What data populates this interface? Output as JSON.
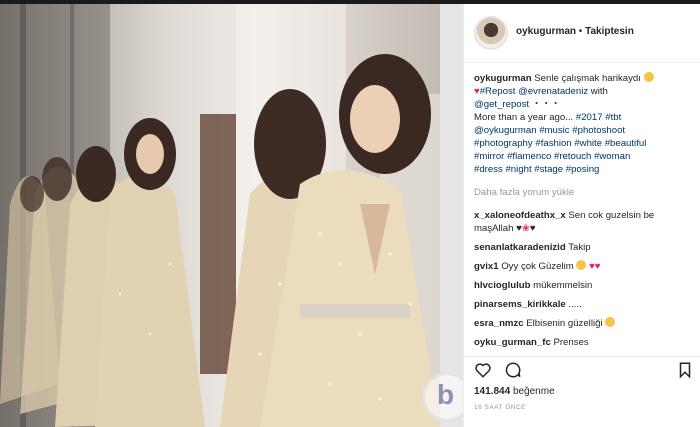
{
  "post": {
    "username": "oykugurman",
    "separator": "•",
    "follow_status": "Takiptesin"
  },
  "caption": {
    "username": "oykugurman",
    "line1": "Senle çalışmak harikaydı",
    "line2_repost": "#Repost",
    "line2_mention": "@evrenatadeniz",
    "line2_with": "with",
    "line3_mention": "@get_repost",
    "line3_dots": "・・・",
    "line4": "More than a year ago...",
    "tags": [
      "#2017",
      "#tbt",
      "@oykugurman",
      "#music",
      "#photoshoot",
      "#photography",
      "#fashion",
      "#white",
      "#beautiful",
      "#mirror",
      "#flamenco",
      "#retouch",
      "#woman",
      "#dress",
      "#night",
      "#stage",
      "#posing"
    ]
  },
  "load_more": "Daha fazla yorum yükle",
  "comments": [
    {
      "user": "x_xaloneofdeathx_x",
      "text": "Sen cok guzelsin be maşAllah"
    },
    {
      "user": "senanlatkaradenizid",
      "text": "Takip"
    },
    {
      "user": "gvix1",
      "text": "Oyy çok Güzelim"
    },
    {
      "user": "hlvcioglulub",
      "text": "mükemmelsin"
    },
    {
      "user": "pinarsems_kirikkale",
      "text": "....."
    },
    {
      "user": "esra_nmzc",
      "text": "Elbisenin güzelliği"
    },
    {
      "user": "oyku_gurman_fc",
      "text": "Prenses"
    }
  ],
  "likes": {
    "count": "141.844",
    "label": "beğenme"
  },
  "time": "16 SAAT ÖNCE",
  "icons": [
    "heart-icon",
    "comment-icon",
    "bookmark-icon"
  ],
  "watermark_letter": "b"
}
